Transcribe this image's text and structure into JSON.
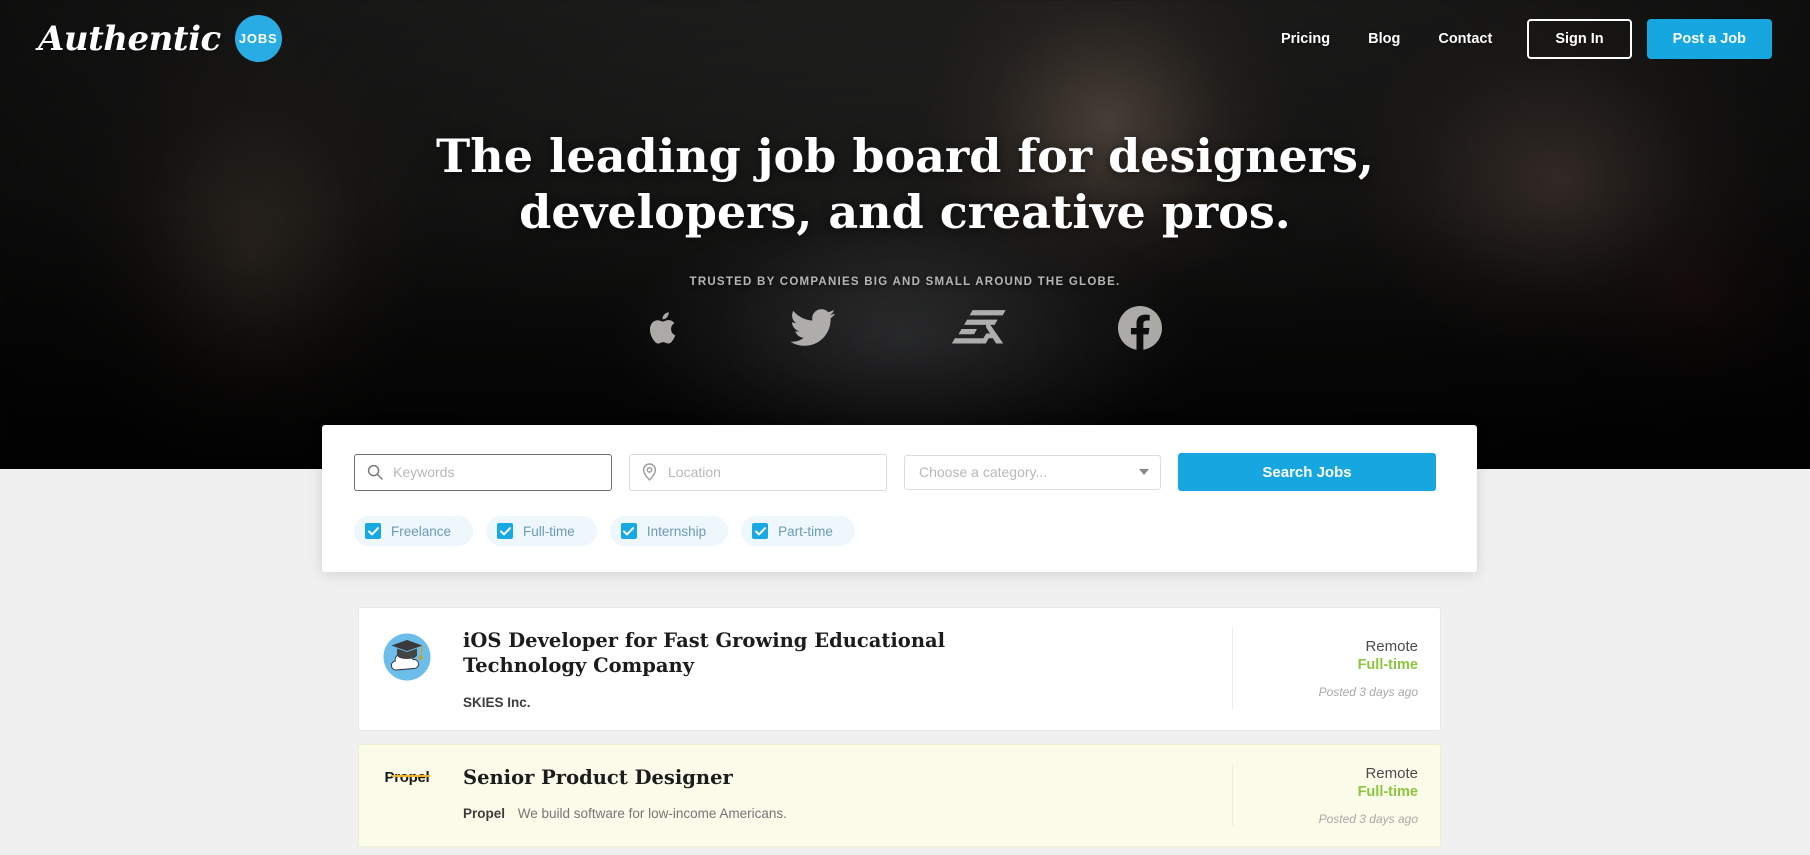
{
  "brand": {
    "wordmark": "Authentic",
    "badge": "JOBS"
  },
  "nav": {
    "links": [
      {
        "label": "Pricing",
        "name": "nav-link-pricing"
      },
      {
        "label": "Blog",
        "name": "nav-link-blog"
      },
      {
        "label": "Contact",
        "name": "nav-link-contact"
      }
    ],
    "sign_in": "Sign In",
    "post_job": "Post a Job"
  },
  "hero": {
    "title": "The leading job board for designers, developers, and creative pros.",
    "trusted_text": "TRUSTED BY COMPANIES BIG AND SMALL AROUND THE GLOBE.",
    "logos": [
      "apple-logo-icon",
      "twitter-logo-icon",
      "ea-logo-icon",
      "facebook-logo-icon"
    ]
  },
  "search": {
    "keywords_placeholder": "Keywords",
    "keywords_value": "",
    "location_placeholder": "Location",
    "location_value": "",
    "category_selected": "Choose a category...",
    "search_button": "Search Jobs",
    "filters": [
      {
        "label": "Freelance",
        "checked": true
      },
      {
        "label": "Full-time",
        "checked": true
      },
      {
        "label": "Internship",
        "checked": true
      },
      {
        "label": "Part-time",
        "checked": true
      }
    ]
  },
  "jobs": [
    {
      "title": "iOS Developer for Fast Growing Educational Technology Company",
      "company": "SKIES Inc.",
      "description": "",
      "location": "Remote",
      "type": "Full-time",
      "posted": "Posted 3 days ago",
      "featured": false,
      "logo": "skies-graduation-cap-logo"
    },
    {
      "title": "Senior Product Designer",
      "company": "Propel",
      "description": "We build software for low-income Americans.",
      "location": "Remote",
      "type": "Full-time",
      "posted": "Posted 3 days ago",
      "featured": true,
      "logo": "propel-logo"
    }
  ],
  "colors": {
    "accent_blue": "#16a7e0",
    "badge_blue": "#29ace3",
    "type_green": "#8cc63e",
    "featured_bg": "#fbfbe9",
    "propel_gold": "#f0b323"
  }
}
